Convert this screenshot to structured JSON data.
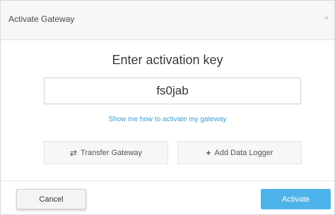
{
  "dialog": {
    "title": "Activate Gateway",
    "close_glyph": "×"
  },
  "content": {
    "heading": "Enter activation key",
    "activation_key_value": "fs0jab",
    "help_link": "Show me how to activate my gateway"
  },
  "actions": {
    "transfer_label": "Transfer Gateway",
    "transfer_icon": "transfer-arrows-icon",
    "add_label": "Add Data Logger",
    "add_icon": "plus-icon"
  },
  "footer": {
    "cancel_label": "Cancel",
    "activate_label": "Activate"
  },
  "colors": {
    "accent": "#4db3ea",
    "link": "#3a9bd9"
  }
}
